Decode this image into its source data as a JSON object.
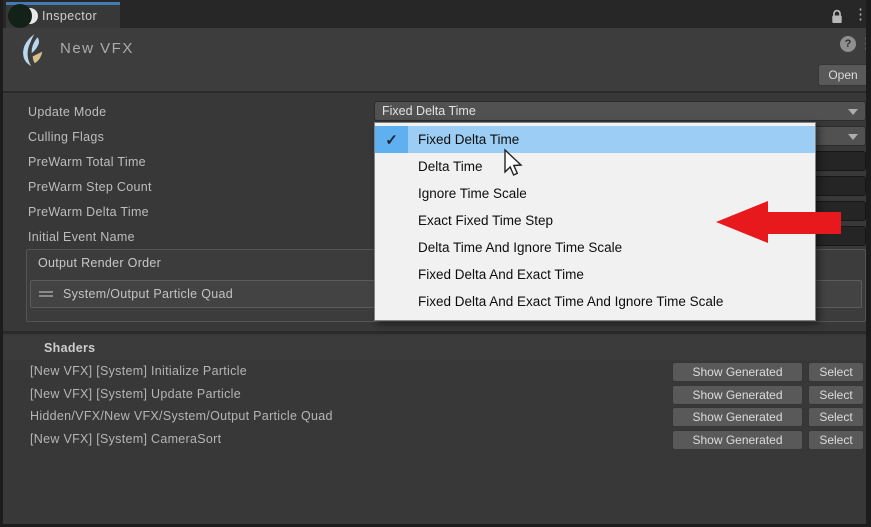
{
  "colors": {
    "tab_accent_blue": "#437bb4",
    "menu_highlight_blue": "#9ccef5",
    "menu_gutter_blue": "#5fb0f0",
    "annotation_arrow_red": "#e7191d",
    "panel_background": "#383838"
  },
  "tab_bar": {
    "title": "Inspector"
  },
  "header": {
    "title": "New VFX",
    "open_button_label": "Open",
    "help_symbol": "?"
  },
  "properties": {
    "rows": [
      {
        "label": "Update Mode",
        "value": "Fixed Delta Time",
        "control": "dropdown"
      },
      {
        "label": "Culling Flags",
        "value": "",
        "control": "dropdown"
      },
      {
        "label": "PreWarm Total Time",
        "value": "",
        "control": "field"
      },
      {
        "label": "PreWarm Step Count",
        "value": "",
        "control": "field"
      },
      {
        "label": "PreWarm Delta Time",
        "value": "",
        "control": "field"
      },
      {
        "label": "Initial Event Name",
        "value": "",
        "control": "field"
      }
    ]
  },
  "output_render_order": {
    "title": "Output Render Order",
    "items": [
      "System/Output Particle Quad"
    ]
  },
  "update_mode_menu": {
    "items": [
      {
        "label": "Fixed Delta Time",
        "checked": true,
        "highlighted": true
      },
      {
        "label": "Delta Time",
        "checked": false,
        "highlighted": false
      },
      {
        "label": "Ignore Time Scale",
        "checked": false,
        "highlighted": false
      },
      {
        "label": "Exact Fixed Time Step",
        "checked": false,
        "highlighted": false
      },
      {
        "label": "Delta Time And Ignore Time Scale",
        "checked": false,
        "highlighted": false
      },
      {
        "label": "Fixed Delta And Exact Time",
        "checked": false,
        "highlighted": false
      },
      {
        "label": "Fixed Delta And Exact Time And Ignore Time Scale",
        "checked": false,
        "highlighted": false
      }
    ]
  },
  "shaders": {
    "title": "Shaders",
    "show_generated_label": "Show Generated",
    "select_label": "Select",
    "rows": [
      "[New VFX] [System] Initialize Particle",
      "[New VFX] [System] Update Particle",
      "Hidden/VFX/New VFX/System/Output Particle Quad",
      "[New VFX] [System] CameraSort"
    ]
  }
}
